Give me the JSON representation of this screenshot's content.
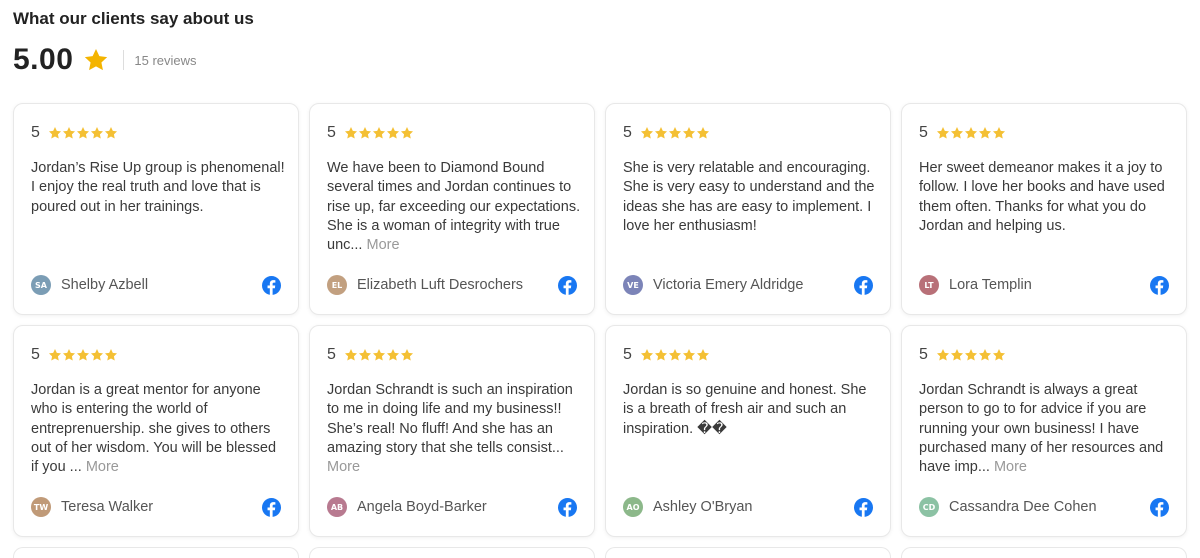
{
  "header": {
    "title": "What our clients say about us"
  },
  "summary": {
    "score": "5.00",
    "reviews_label": "15 reviews",
    "star_color": "#F4B400"
  },
  "colors": {
    "star": "#F4C034",
    "facebook": "#1877F2"
  },
  "reviews": [
    {
      "rating": "5",
      "text": "Jordan’s Rise Up group is phenomenal! I enjoy the real truth and love that is poured out in her trainings.",
      "more": "",
      "initials": "SA",
      "avatar_color": "#7B9DB5",
      "name": "Shelby Azbell",
      "source_icon": "facebook-icon"
    },
    {
      "rating": "5",
      "text": "We have been to Diamond Bound several times and Jordan continues to rise up, far exceeding our expectations. She is a woman of integrity with true unc...",
      "more": "More",
      "initials": "EL",
      "avatar_color": "#C2A080",
      "name": "Elizabeth Luft Desrochers",
      "source_icon": "facebook-icon"
    },
    {
      "rating": "5",
      "text": "She is very relatable and encouraging. She is very easy to understand and the ideas she has are easy to implement. I love her enthusiasm!",
      "more": "",
      "initials": "VE",
      "avatar_color": "#7C84B8",
      "name": "Victoria Emery Aldridge",
      "source_icon": "facebook-icon"
    },
    {
      "rating": "5",
      "text": "Her sweet demeanor makes it a joy to follow. I love her books and have used them often. Thanks for what you do Jordan and helping us.",
      "more": "",
      "initials": "LT",
      "avatar_color": "#B87078",
      "name": "Lora Templin",
      "source_icon": "facebook-icon"
    },
    {
      "rating": "5",
      "text": "Jordan is a great mentor for anyone who is entering the world of entreprenuership. she gives to others out of her wisdom. You will be blessed if you ...",
      "more": "More",
      "initials": "TW",
      "avatar_color": "#C09A78",
      "name": "Teresa Walker",
      "source_icon": "facebook-icon"
    },
    {
      "rating": "5",
      "text": "Jordan Schrandt is such an inspiration to me in doing life and my business!! She’s real! No fluff! And she has an amazing story that she tells consist...",
      "more": "More",
      "initials": "AB",
      "avatar_color": "#B87A90",
      "name": "Angela Boyd-Barker",
      "source_icon": "facebook-icon"
    },
    {
      "rating": "5",
      "text": "Jordan is so genuine and honest. She is a breath of fresh air and such an inspiration. ��",
      "more": "",
      "initials": "AO",
      "avatar_color": "#8CB88A",
      "name": "Ashley O'Bryan",
      "source_icon": "facebook-icon"
    },
    {
      "rating": "5",
      "text": "Jordan Schrandt is always a great person to go to for advice if you are running your own business! I have purchased many of her resources and have imp...",
      "more": "More",
      "initials": "CD",
      "avatar_color": "#8CC2A4",
      "name": "Cassandra Dee Cohen",
      "source_icon": "facebook-icon"
    }
  ]
}
